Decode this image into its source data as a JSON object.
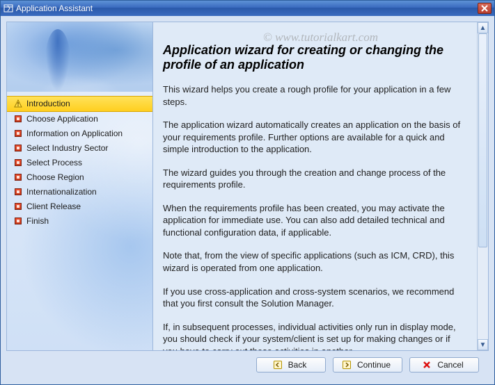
{
  "titlebar": {
    "title": "Application Assistant"
  },
  "watermark": "© www.tutorialkart.com",
  "sidebar": {
    "items": [
      {
        "label": "Introduction",
        "selected": true
      },
      {
        "label": "Choose Application",
        "selected": false
      },
      {
        "label": "Information on Application",
        "selected": false
      },
      {
        "label": "Select Industry Sector",
        "selected": false
      },
      {
        "label": "Select Process",
        "selected": false
      },
      {
        "label": "Choose Region",
        "selected": false
      },
      {
        "label": "Internationalization",
        "selected": false
      },
      {
        "label": "Client Release",
        "selected": false
      },
      {
        "label": "Finish",
        "selected": false
      }
    ]
  },
  "main": {
    "heading": "Application wizard for creating or changing the profile of an application",
    "paragraphs": [
      "This wizard helps you create a rough profile for your application in a few steps.",
      "The application wizard automatically creates an application on the basis of your requirements profile. Further options are available for a quick and simple introduction to the application.",
      "The wizard guides you through the creation and change process of the requirements profile.",
      "When the requirements profile has been created, you may activate the application for immediate use. You can also add detailed technical and functional configuration data, if applicable.",
      "Note that, from the view of specific applications (such as ICM, CRD), this wizard is operated from one application.",
      "If you use cross-application and cross-system scenarios, we recommend that you first consult the Solution Manager.",
      "If, in subsequent processes, individual activities only run in display mode, you should check if your system/client is set up for making changes or if you have to carry out these activities in another"
    ]
  },
  "buttons": {
    "back": "Back",
    "continue": "Continue",
    "cancel": "Cancel"
  }
}
